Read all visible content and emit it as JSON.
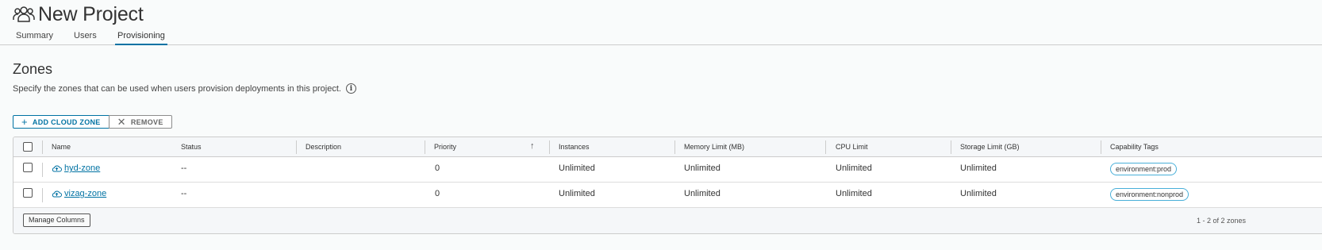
{
  "header": {
    "title": "New Project",
    "icon": "users-icon"
  },
  "tabs": [
    {
      "label": "Summary",
      "active": false
    },
    {
      "label": "Users",
      "active": false
    },
    {
      "label": "Provisioning",
      "active": true
    }
  ],
  "section": {
    "title": "Zones",
    "description": "Specify the zones that can be used when users provision deployments in this project.",
    "info_icon": "info-icon"
  },
  "toolbar": {
    "add_label": "ADD CLOUD ZONE",
    "remove_label": "REMOVE"
  },
  "grid": {
    "columns": [
      "Name",
      "Status",
      "Description",
      "Priority",
      "Instances",
      "Memory Limit (MB)",
      "CPU Limit",
      "Storage Limit (GB)",
      "Capability Tags"
    ],
    "sort_indicator": "↑",
    "rows": [
      {
        "name": "hyd-zone",
        "status": "--",
        "description": "",
        "priority": "0",
        "instances": "Unlimited",
        "memory": "Unlimited",
        "cpu": "Unlimited",
        "storage": "Unlimited",
        "tag": "environment:prod"
      },
      {
        "name": "vizag-zone",
        "status": "--",
        "description": "",
        "priority": "0",
        "instances": "Unlimited",
        "memory": "Unlimited",
        "cpu": "Unlimited",
        "storage": "Unlimited",
        "tag": "environment:nonprod"
      }
    ],
    "footer": {
      "manage_label": "Manage Columns",
      "pagination": "1 - 2 of 2 zones"
    }
  },
  "colors": {
    "accent": "#0072a3",
    "tag_border": "#49afd9"
  }
}
